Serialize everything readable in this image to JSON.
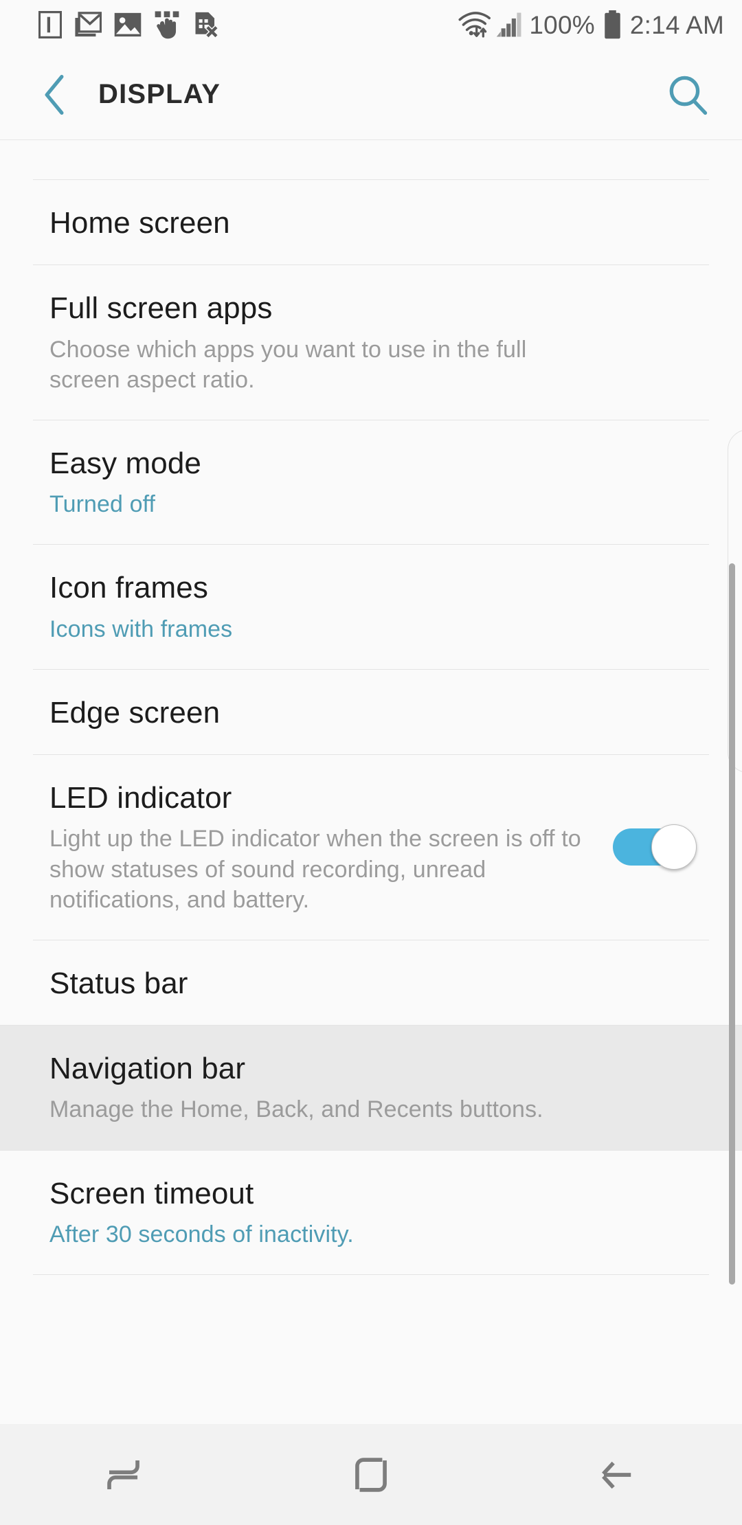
{
  "status_bar": {
    "notification_icons": [
      {
        "name": "ebook-reader-icon"
      },
      {
        "name": "gmail-icon"
      },
      {
        "name": "photo-image-icon"
      },
      {
        "name": "touch-gesture-icon"
      },
      {
        "name": "no-sim-card-icon"
      }
    ],
    "wifi_icon": "wifi-with-data-transfer-icon",
    "signal_icon": "cellular-signal-icon",
    "battery_percent": "100%",
    "battery_icon": "battery-full-icon",
    "time": "2:14 AM"
  },
  "title_bar": {
    "back_icon": "back-chevron-icon",
    "title": "DISPLAY",
    "search_icon": "search-icon"
  },
  "colors": {
    "accent_teal": "#4f9cb4",
    "toggle_on": "#4bb4de",
    "page_background": "#fafafa",
    "highlight_row": "#e9e9e9",
    "divider": "#e4e4e4",
    "nav_bar_background": "#f2f2f2"
  },
  "settings_list": [
    {
      "id": "home-screen",
      "title": "Home screen",
      "subtitle": null,
      "subtitle_style": null,
      "has_toggle": false,
      "highlighted": false
    },
    {
      "id": "full-screen-apps",
      "title": "Full screen apps",
      "subtitle": "Choose which apps you want to use in the full screen aspect ratio.",
      "subtitle_style": "muted",
      "has_toggle": false,
      "highlighted": false
    },
    {
      "id": "easy-mode",
      "title": "Easy mode",
      "subtitle": "Turned off",
      "subtitle_style": "accent",
      "has_toggle": false,
      "highlighted": false
    },
    {
      "id": "icon-frames",
      "title": "Icon frames",
      "subtitle": "Icons with frames",
      "subtitle_style": "accent",
      "has_toggle": false,
      "highlighted": false
    },
    {
      "id": "edge-screen",
      "title": "Edge screen",
      "subtitle": null,
      "subtitle_style": null,
      "has_toggle": false,
      "highlighted": false
    },
    {
      "id": "led-indicator",
      "title": "LED indicator",
      "subtitle": "Light up the LED indicator when the screen is off to show statuses of sound recording, unread notifications, and battery.",
      "subtitle_style": "muted",
      "has_toggle": true,
      "toggle_state": "on",
      "highlighted": false
    },
    {
      "id": "status-bar",
      "title": "Status bar",
      "subtitle": null,
      "subtitle_style": null,
      "has_toggle": false,
      "highlighted": false
    },
    {
      "id": "navigation-bar",
      "title": "Navigation bar",
      "subtitle": "Manage the Home, Back, and Recents buttons.",
      "subtitle_style": "muted",
      "has_toggle": false,
      "highlighted": true
    },
    {
      "id": "screen-timeout",
      "title": "Screen timeout",
      "subtitle": "After 30 seconds of inactivity.",
      "subtitle_style": "accent",
      "has_toggle": false,
      "highlighted": false
    }
  ],
  "nav_bar": {
    "recents_icon": "recents-icon",
    "home_icon": "home-icon",
    "back_icon": "back-arrow-icon"
  }
}
